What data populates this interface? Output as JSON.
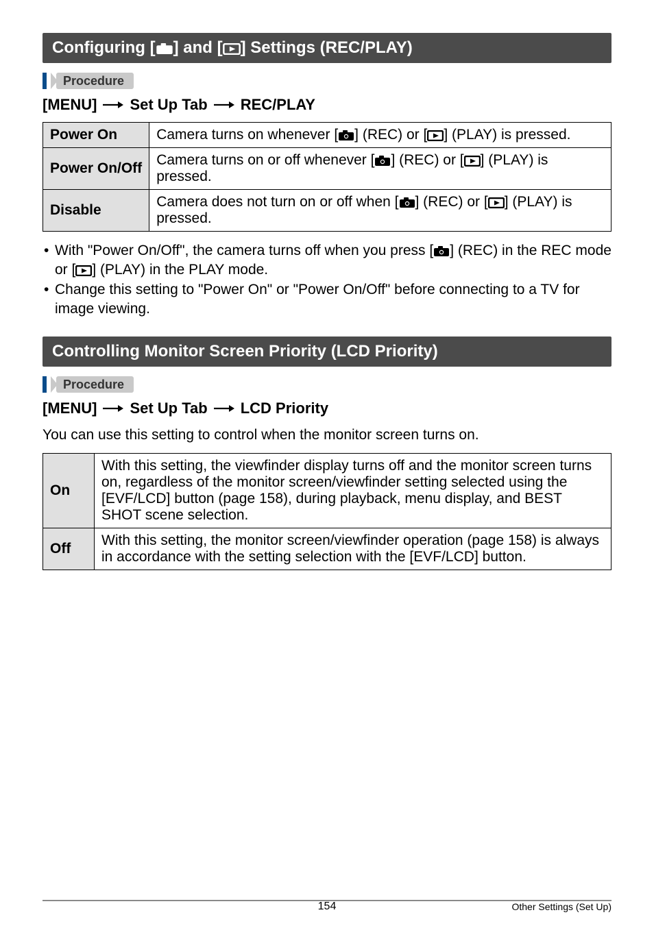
{
  "sections": {
    "recplay": {
      "title": "Configuring [REC] and [PLAY] Settings (REC/PLAY)",
      "title_prefix": "Configuring [",
      "title_mid1": "] and [",
      "title_mid2": "] Settings (REC/PLAY)",
      "procedure_label": "Procedure",
      "breadcrumb": {
        "menu": "[MENU]",
        "tab": "Set Up Tab",
        "item": "REC/PLAY"
      },
      "table": [
        {
          "label": "Power On",
          "desc_prefix": "Camera turns on whenever [",
          "desc_mid": "] (REC) or [",
          "desc_suffix": "] (PLAY) is pressed."
        },
        {
          "label": "Power On/Off",
          "desc_prefix": "Camera turns on or off whenever [",
          "desc_mid": "] (REC) or [",
          "desc_suffix": "] (PLAY) is pressed."
        },
        {
          "label": "Disable",
          "desc_prefix": "Camera does not turn on or off when [",
          "desc_mid": "] (REC) or [",
          "desc_suffix": "] (PLAY) is pressed."
        }
      ],
      "bullets": {
        "b1_prefix": "With \"Power On/Off\", the camera turns off when you press [",
        "b1_mid": "] (REC) in the REC mode or [",
        "b1_suffix": "] (PLAY) in the PLAY mode.",
        "b2": "Change this setting to \"Power On\" or \"Power On/Off\" before connecting to a TV for image viewing."
      }
    },
    "lcd": {
      "title": "Controlling Monitor Screen Priority (LCD Priority)",
      "procedure_label": "Procedure",
      "breadcrumb": {
        "menu": "[MENU]",
        "tab": "Set Up Tab",
        "item": "LCD Priority"
      },
      "intro": "You can use this setting to control when the monitor screen turns on.",
      "table": [
        {
          "label": "On",
          "desc": "With this setting, the viewfinder display turns off and the monitor screen turns on, regardless of the monitor screen/viewfinder setting selected using the [EVF/LCD] button (page 158), during playback, menu display, and BEST SHOT scene selection."
        },
        {
          "label": "Off",
          "desc": "With this setting, the monitor screen/viewfinder operation (page 158) is always in accordance with the setting selection with the [EVF/LCD] button."
        }
      ]
    }
  },
  "footer": {
    "page": "154",
    "section": "Other Settings (Set Up)"
  },
  "icons": {
    "camera": "camera-icon",
    "play": "play-icon",
    "arrow": "arrow-right-icon"
  }
}
